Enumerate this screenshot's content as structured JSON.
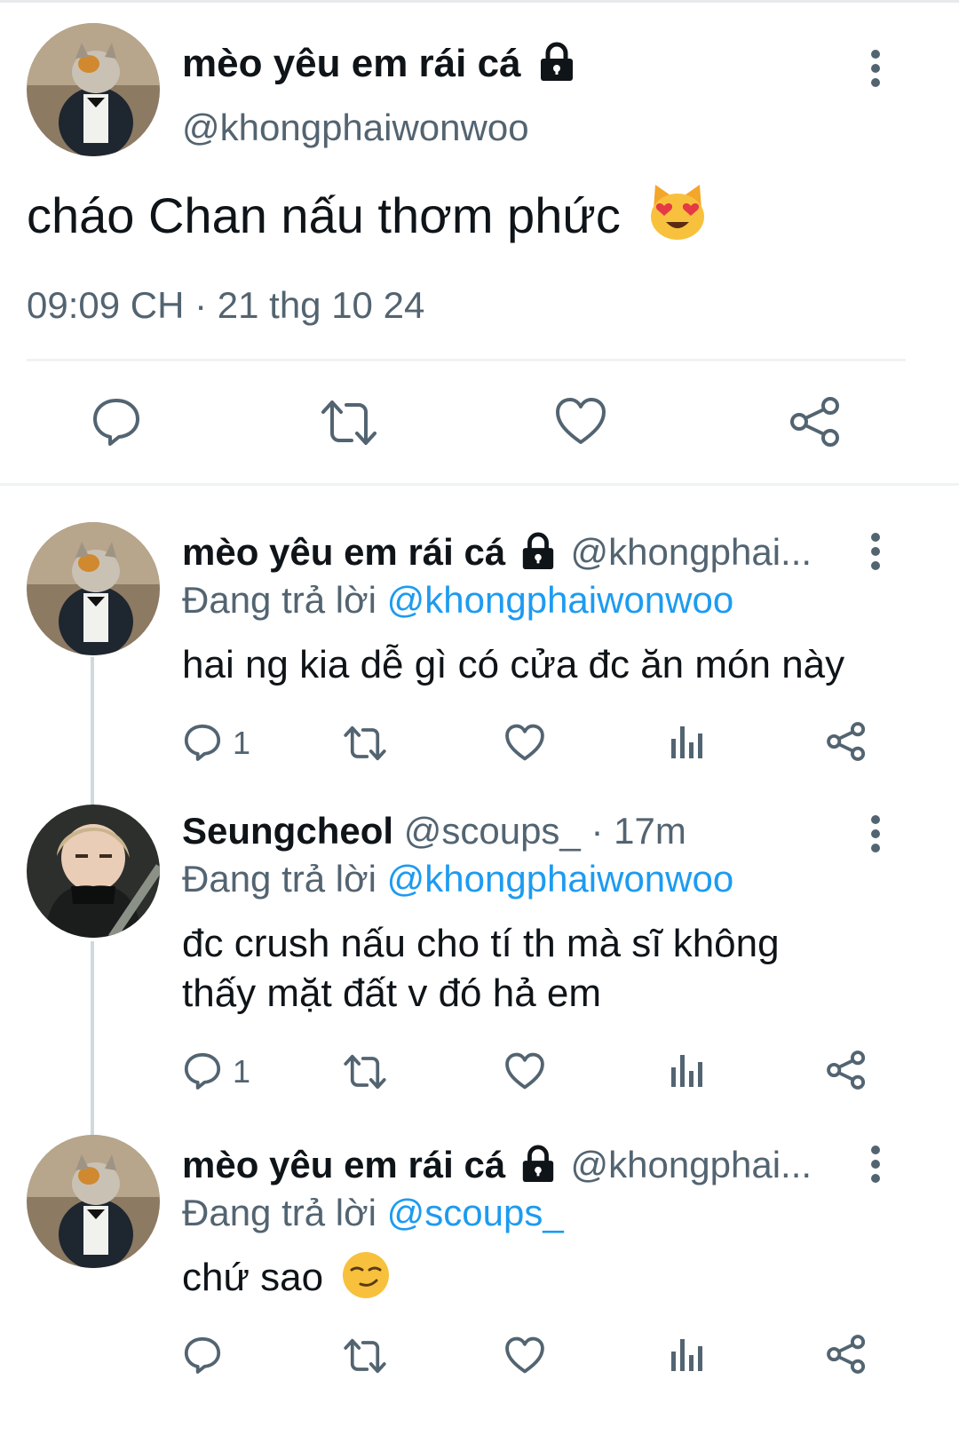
{
  "main_tweet": {
    "display_name": "mèo yêu em rái cá",
    "handle": "@khongphaiwonwoo",
    "text": "cháo Chan nấu thơm phức",
    "emoji": "smiling-cat-heart-eyes",
    "timestamp": "09:09 CH · 21 thg 10 24"
  },
  "replies": [
    {
      "display_name": "mèo yêu em rái cá",
      "handle": "@khongphai...",
      "meta": "",
      "replying_label": "Đang trả lời",
      "replying_to": "@khongphaiwonwoo",
      "text_lines": [
        "hai ng kia dễ gì có cửa đc ăn món này"
      ],
      "reply_count": "1"
    },
    {
      "display_name": "Seungcheol",
      "handle": "@scoups_",
      "meta": "· 17m",
      "replying_label": "Đang trả lời",
      "replying_to": "@khongphaiwonwoo",
      "text_lines": [
        "đc crush nấu cho tí th mà sĩ không",
        "thấy mặt đất v đó hả em"
      ],
      "reply_count": "1"
    },
    {
      "display_name": "mèo yêu em rái cá",
      "handle": "@khongphai...",
      "meta": "",
      "replying_label": "Đang trả lời",
      "replying_to": "@scoups_",
      "text_lines": [
        "chứ sao"
      ],
      "emoji": "smirking-face",
      "reply_count": ""
    }
  ],
  "colors": {
    "text": "#0f1419",
    "muted": "#536471",
    "link": "#1d9bf0",
    "divider": "#eff3f4"
  }
}
